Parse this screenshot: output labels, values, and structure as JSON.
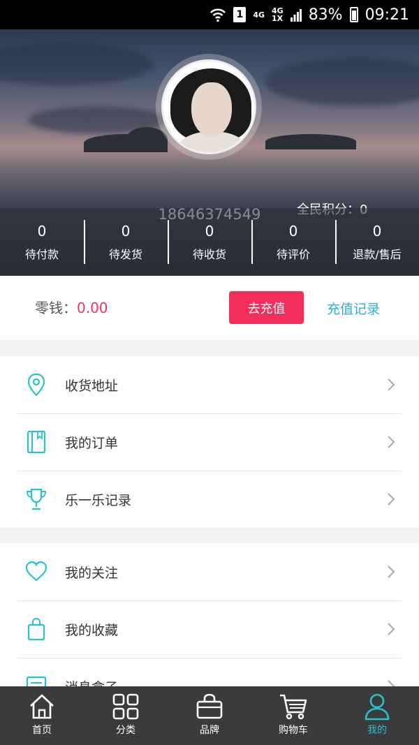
{
  "status_bar": {
    "network_1": "4G",
    "network_2": "4G",
    "network_2_sub": "1X",
    "sim": "1",
    "battery": "83%",
    "time": "09:21"
  },
  "profile": {
    "phone": "18646374549",
    "points_label": "全民积分：",
    "points_value": "0"
  },
  "orders": [
    {
      "count": "0",
      "label": "待付款"
    },
    {
      "count": "0",
      "label": "待发货"
    },
    {
      "count": "0",
      "label": "待收货"
    },
    {
      "count": "0",
      "label": "待评价"
    },
    {
      "count": "0",
      "label": "退款/售后"
    }
  ],
  "wallet": {
    "label": "零钱：",
    "amount": "0.00",
    "recharge_button": "去充值",
    "records_link": "充值记录"
  },
  "menu_group_1": [
    {
      "label": "收货地址",
      "icon": "location-pin-icon"
    },
    {
      "label": "我的订单",
      "icon": "order-book-icon"
    },
    {
      "label": "乐一乐记录",
      "icon": "trophy-icon"
    }
  ],
  "menu_group_2": [
    {
      "label": "我的关注",
      "icon": "heart-icon"
    },
    {
      "label": "我的收藏",
      "icon": "shopping-bag-icon"
    },
    {
      "label": "消息盒子",
      "icon": "message-box-icon"
    }
  ],
  "bottom_nav": [
    {
      "label": "首页",
      "icon": "home-icon"
    },
    {
      "label": "分类",
      "icon": "category-grid-icon"
    },
    {
      "label": "品牌",
      "icon": "brand-bag-icon"
    },
    {
      "label": "购物车",
      "icon": "cart-icon"
    },
    {
      "label": "我的",
      "icon": "user-icon",
      "active": true
    }
  ],
  "colors": {
    "accent": "#27c3c9",
    "recharge_button": "#f22e5a",
    "amount": "#e8385a",
    "records_link": "#2bb0c9",
    "nav_bg": "#3b3b3d"
  }
}
